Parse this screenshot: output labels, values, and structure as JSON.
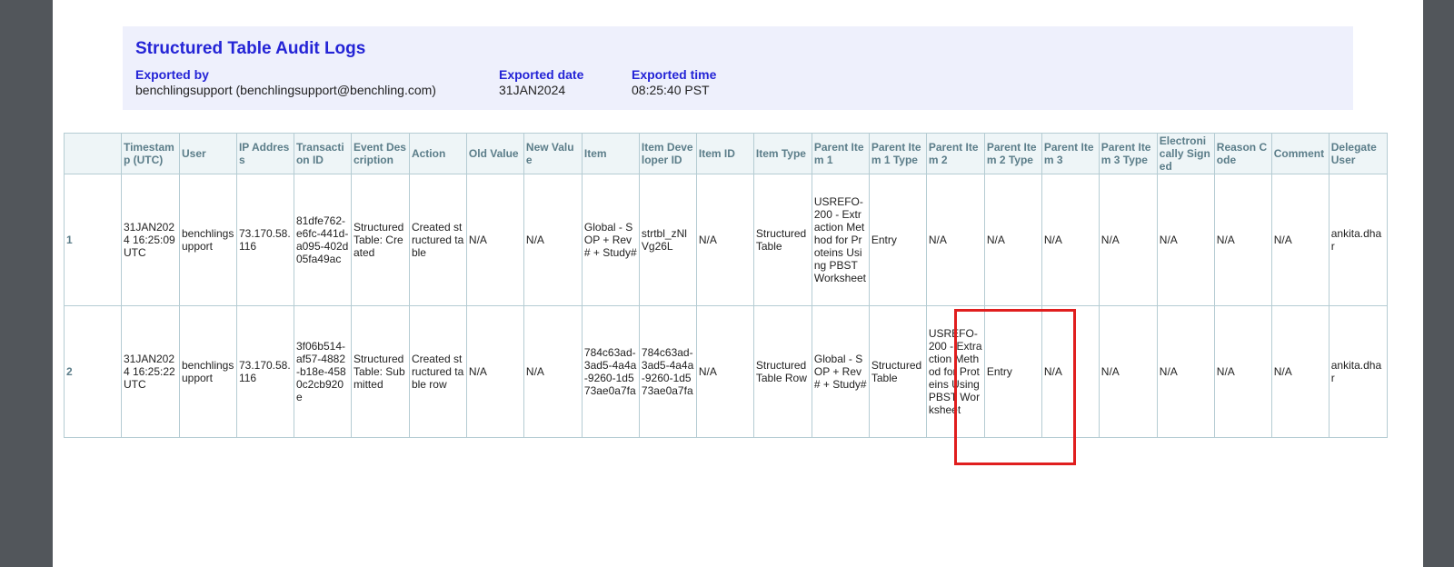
{
  "header": {
    "title": "Structured Table Audit Logs",
    "exported_by_label": "Exported by",
    "exported_by_value": "benchlingsupport (benchlingsupport@benchling.com)",
    "exported_date_label": "Exported date",
    "exported_date_value": "31JAN2024",
    "exported_time_label": "Exported time",
    "exported_time_value": "08:25:40 PST"
  },
  "table": {
    "columns": [
      "",
      "Timestamp (UTC)",
      "User",
      "IP Address",
      "Transaction ID",
      "Event Description",
      "Action",
      "Old Value",
      "New Value",
      "Item",
      "Item Developer ID",
      "Item ID",
      "Item Type",
      "Parent Item 1",
      "Parent Item 1 Type",
      "Parent Item 2",
      "Parent Item 2 Type",
      "Parent Item 3",
      "Parent Item 3 Type",
      "Electronically Signed",
      "Reason Code",
      "Comment",
      "Delegate User"
    ],
    "rows": [
      [
        "1",
        "31JAN2024 16:25:09 UTC",
        "benchlingsupport",
        "73.170.58.116",
        "81dfe762-e6fc-441d-a095-402d05fa49ac",
        "Structured Table: Created",
        "Created structured table",
        "N/A",
        "N/A",
        "Global - SOP + Rev# + Study#",
        "strtbl_zNlVg26L",
        "N/A",
        "Structured Table",
        "USREFO-200 - Extraction Method for Proteins Using PBST Worksheet",
        "Entry",
        "N/A",
        "N/A",
        "N/A",
        "N/A",
        "N/A",
        "N/A",
        "N/A",
        "ankita.dhar"
      ],
      [
        "2",
        "31JAN2024 16:25:22 UTC",
        "benchlingsupport",
        "73.170.58.116",
        "3f06b514-af57-4882-b18e-4580c2cb920e",
        "Structured Table: Submitted",
        "Created structured table row",
        "N/A",
        "N/A",
        "784c63ad-3ad5-4a4a-9260-1d573ae0a7fa",
        "784c63ad-3ad5-4a4a-9260-1d573ae0a7fa",
        "N/A",
        "Structured Table Row",
        "Global - SOP + Rev# + Study#",
        "Structured Table",
        "USREFO-200 - Extraction Method for Proteins Using PBST Worksheet",
        "Entry",
        "N/A",
        "N/A",
        "N/A",
        "N/A",
        "N/A",
        "ankita.dhar"
      ]
    ]
  },
  "colors": {
    "header_label": "#2424d6",
    "table_header_text": "#5b7d89",
    "highlight_border": "#e01e1e"
  }
}
